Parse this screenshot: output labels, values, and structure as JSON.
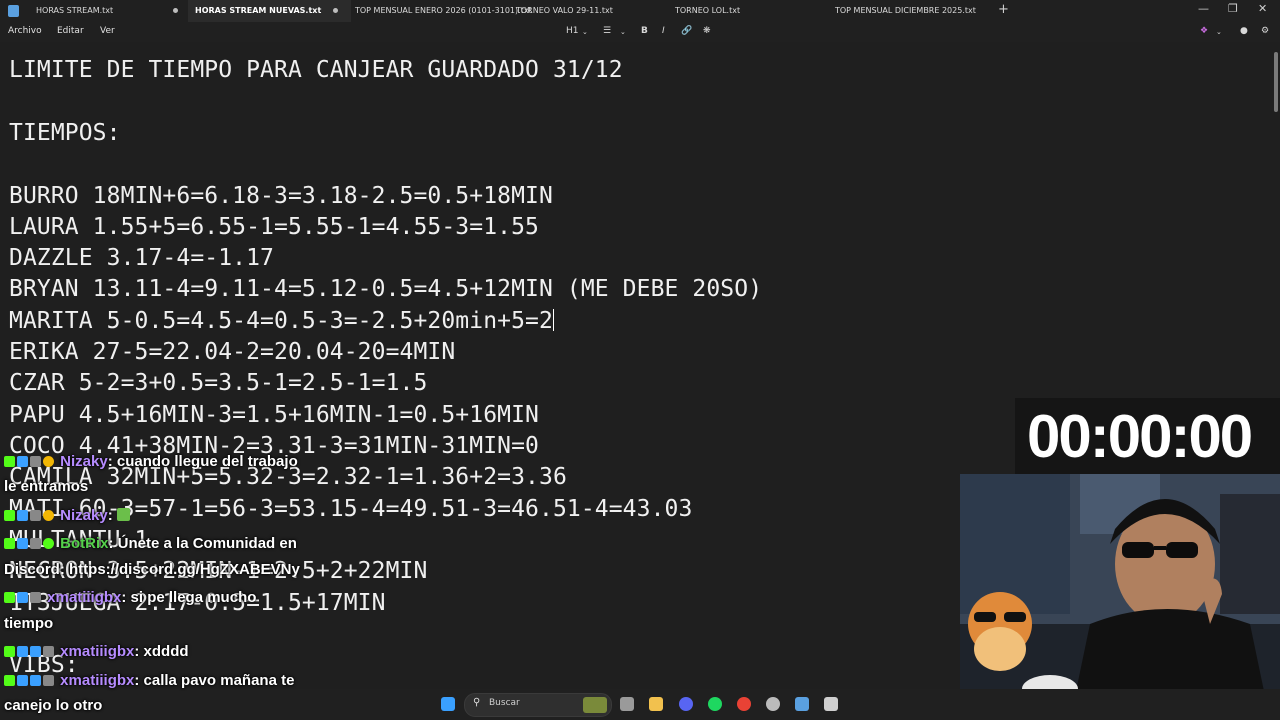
{
  "tabs": [
    {
      "label": "HORAS STREAM.txt",
      "active": false,
      "unsaved": true
    },
    {
      "label": "HORAS STREAM NUEVAS.txt",
      "active": true,
      "unsaved": true
    },
    {
      "label": "TOP MENSUAL ENERO 2026 (0101-3101).txt",
      "active": false,
      "unsaved": false
    },
    {
      "label": "TORNEO VALO 29-11.txt",
      "active": false,
      "unsaved": false
    },
    {
      "label": "TORNEO LOL.txt",
      "active": false,
      "unsaved": false
    },
    {
      "label": "TOP MENSUAL DICIEMBRE 2025.txt",
      "active": false,
      "unsaved": false
    }
  ],
  "menu": [
    "Archivo",
    "Editar",
    "Ver"
  ],
  "format": {
    "heading": "H1",
    "bold": "B",
    "italic": "I"
  },
  "editor_lines": [
    "LIMITE DE TIEMPO PARA CANJEAR GUARDADO 31/12",
    "",
    "TIEMPOS:",
    "",
    "BURRO 18MIN+6=6.18-3=3.18-2.5=0.5+18MIN",
    "LAURA 1.55+5=6.55-1=5.55-1=4.55-3=1.55",
    "DAZZLE 3.17-4=-1.17",
    "BRYAN 13.11-4=9.11-4=5.12-0.5=4.5+12MIN (ME DEBE 20SO)",
    "MARITA 5-0.5=4.5-4=0.5-3=-2.5+20min+5=2",
    "ERIKA 27-5=22.04-2=20.04-20=4MIN",
    "CZAR 5-2=3+0.5=3.5-1=2.5-1=1.5",
    "PAPU 4.5+16MIN-3=1.5+16MIN-1=0.5+16MIN",
    "COCO 4.41+38MIN-2=3.31-3=31MIN-31MIN=0",
    "CAMILA 32MIN+5=5.32-3=2.32-1=1.36+2=3.36",
    "MATI 60-3=57-1=56-3=53.15-4=49.51-3=46.51-4=43.03",
    "MULTANTU 1",
    "NECRON 3.5+22MIN-1=2.5+2+22MIN",
    "1T3JUEGA 2.17-0.5=1.5+17MIN",
    "",
    "VIBS:"
  ],
  "timer": "00:00:00",
  "chat": [
    {
      "user": "Nizaky",
      "msg": ": cuando llegue del trabajo",
      "wrap": "le entramos"
    },
    {
      "user": "Nizaky",
      "msg": ":",
      "wrap": ""
    },
    {
      "user": "BotRix",
      "msg": ": Únete a la Comunidad en",
      "wrap": "Discord: https://discord.gg/HgZXABEVNy"
    },
    {
      "user": "xmatiiigbx",
      "msg": ": si pe llega mucho",
      "wrap": "tiempo"
    },
    {
      "user": "xmatiiigbx",
      "msg": ": xdddd",
      "wrap": ""
    },
    {
      "user": "xmatiiigbx",
      "msg": ": calla pavo mañana te",
      "wrap": "canejo lo otro"
    }
  ],
  "taskbar": {
    "search_placeholder": "Buscar"
  },
  "colors": {
    "accent": "#5aa0e0",
    "chat_user": "#b68cff",
    "bot_user": "#54d14a"
  }
}
